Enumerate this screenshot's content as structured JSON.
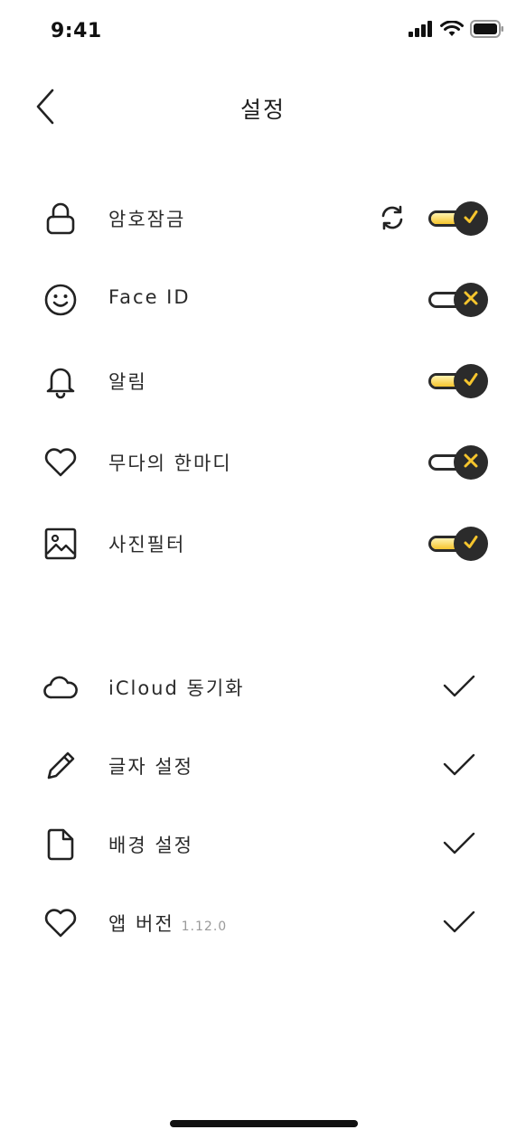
{
  "status_bar": {
    "time": "9:41"
  },
  "header": {
    "title": "설정"
  },
  "toggle_rows": [
    {
      "label": "암호잠금",
      "icon": "lock-icon",
      "enabled": true,
      "has_sync": true
    },
    {
      "label": "Face ID",
      "icon": "smile-icon",
      "enabled": false,
      "has_sync": false
    },
    {
      "label": "알림",
      "icon": "bell-icon",
      "enabled": true,
      "has_sync": false
    },
    {
      "label": "무다의 한마디",
      "icon": "heart-icon",
      "enabled": false,
      "has_sync": false
    },
    {
      "label": "사진필터",
      "icon": "image-icon",
      "enabled": true,
      "has_sync": false
    }
  ],
  "check_rows": [
    {
      "label": "iCloud 동기화",
      "icon": "cloud-icon"
    },
    {
      "label": "글자 설정",
      "icon": "pencil-icon"
    },
    {
      "label": "배경 설정",
      "icon": "file-icon"
    },
    {
      "label": "앱 버전",
      "icon": "heart-icon",
      "version": "1.12.0"
    }
  ],
  "colors": {
    "accent": "#f6c52d",
    "knob": "#2b2b2b",
    "text": "#1f1f1f"
  }
}
